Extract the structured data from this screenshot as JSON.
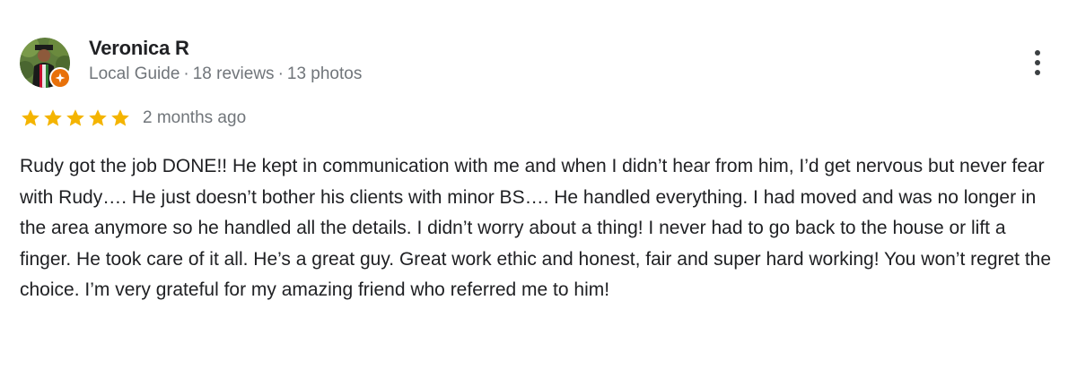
{
  "review": {
    "reviewer": {
      "name": "Veronica R",
      "badge": "Local Guide",
      "reviews_count": "18 reviews",
      "photos_count": "13 photos",
      "separator": "·",
      "avatar_icon": "profile-photo",
      "badge_icon": "local-guide-badge-icon"
    },
    "rating": {
      "stars": 5,
      "max": 5,
      "color": "#F4B400"
    },
    "date": "2 months ago",
    "more_icon": "more-vert-icon",
    "text": "Rudy got the job DONE!! He kept in communication with me and when I didn’t hear from him, I’d get nervous but never fear with Rudy…. He just doesn’t bother his clients with minor BS…. He handled everything. I had moved and was no longer in the area anymore so he handled all the details. I didn’t worry about a thing! I never had to go back to the house or lift a finger. He took care of it all. He’s a great guy. Great work ethic and honest, fair and super hard working! You won’t regret the choice. I’m very grateful for my amazing friend who referred me to him!"
  }
}
